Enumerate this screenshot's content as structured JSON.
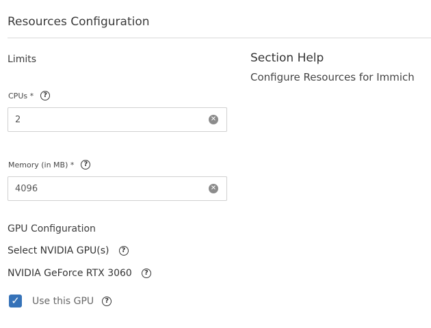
{
  "section": {
    "title": "Resources Configuration",
    "limits_label": "Limits"
  },
  "help": {
    "title": "Section Help",
    "text": "Configure Resources for Immich"
  },
  "fields": {
    "cpus": {
      "label": "CPUs *",
      "value": "2"
    },
    "memory": {
      "label": "Memory (in MB) *",
      "value": "4096"
    }
  },
  "gpu": {
    "title": "GPU Configuration",
    "select_label": "Select NVIDIA GPU(s)",
    "device_name": "NVIDIA GeForce RTX 3060",
    "use_label": "Use this GPU",
    "use_checked": true
  },
  "icons": {
    "help": "help-circle-icon",
    "clear": "clear-circle-icon",
    "check": "checkmark-icon"
  },
  "colors": {
    "checkbox": "#3572b8",
    "divider": "#d9d9d9"
  }
}
